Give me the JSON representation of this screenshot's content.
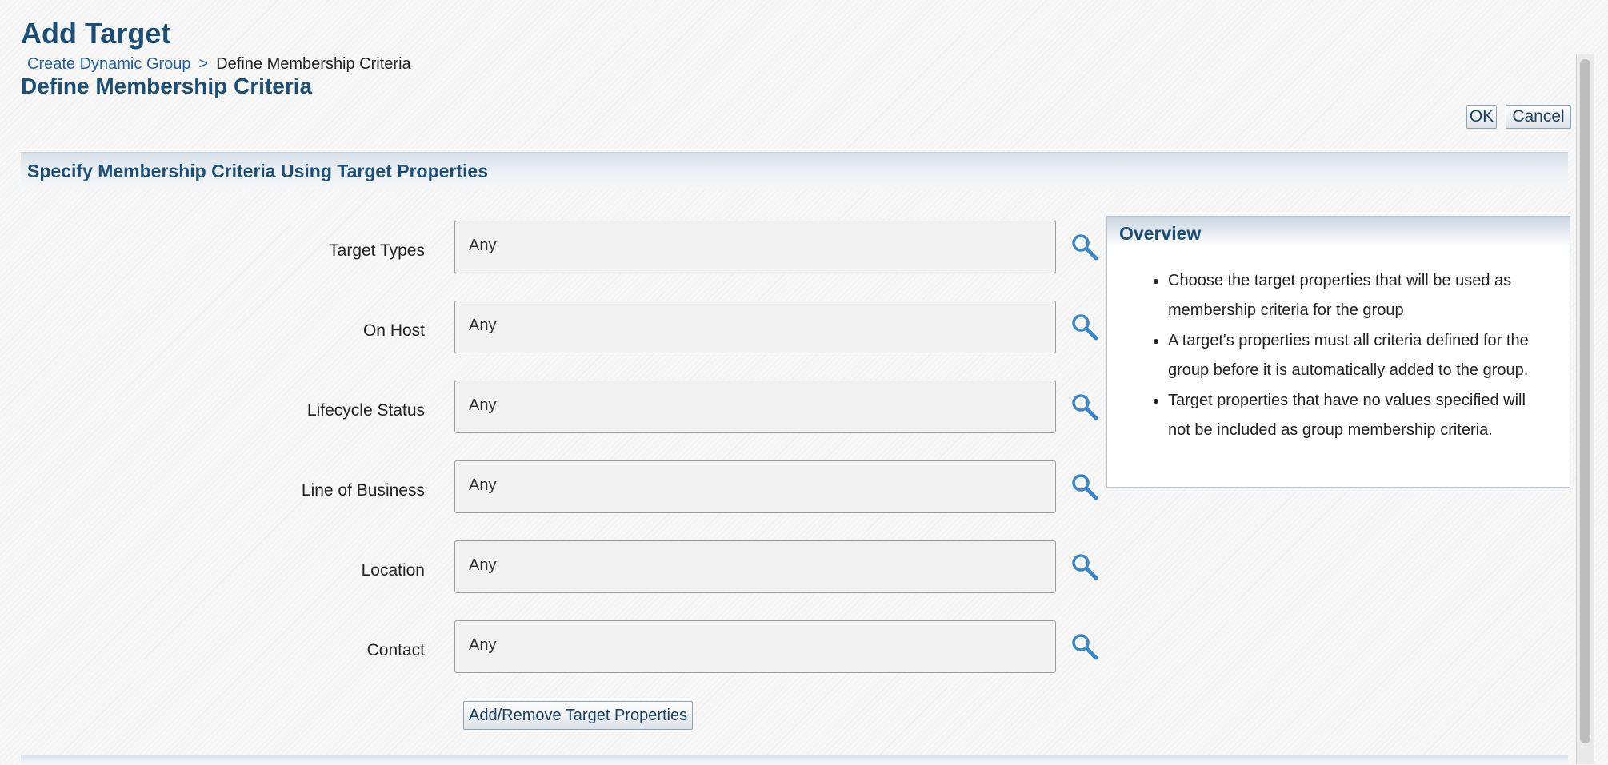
{
  "page": {
    "title": "Add Target",
    "subtitle": "Define Membership Criteria"
  },
  "breadcrumb": {
    "link": "Create Dynamic Group",
    "separator": ">",
    "current": "Define Membership Criteria"
  },
  "actions": {
    "ok_label": "OK",
    "cancel_label": "Cancel"
  },
  "criteria_section": {
    "title": "Specify Membership Criteria Using Target Properties",
    "rows": [
      {
        "label": "Target Types",
        "value": "Any",
        "icon": "search-icon"
      },
      {
        "label": "On Host",
        "value": "Any",
        "icon": "search-icon"
      },
      {
        "label": "Lifecycle Status",
        "value": "Any",
        "icon": "search-icon"
      },
      {
        "label": "Line of Business",
        "value": "Any",
        "icon": "search-icon"
      },
      {
        "label": "Location",
        "value": "Any",
        "icon": "search-icon"
      },
      {
        "label": "Contact",
        "value": "Any",
        "icon": "search-icon"
      }
    ],
    "add_remove_label": "Add/Remove Target Properties"
  },
  "overview": {
    "title": "Overview",
    "items": [
      "Choose the target properties that will be used as membership criteria for the group",
      "A target's properties must all criteria defined for the group before it is automatically added to the group.",
      "Target properties that have no values specified will not be included as group membership criteria."
    ]
  },
  "colors": {
    "heading": "#1d4f76",
    "link": "#1f5ea8",
    "icon": "#3a86c8"
  }
}
